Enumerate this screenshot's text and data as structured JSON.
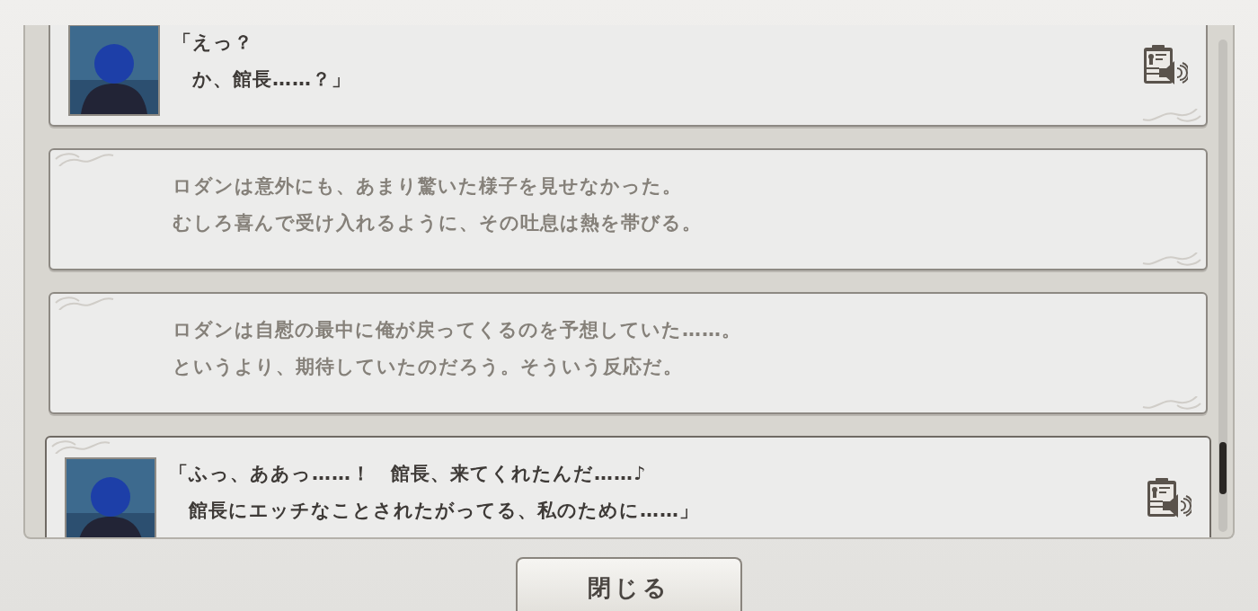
{
  "backlog": {
    "entries": [
      {
        "kind": "voice",
        "selected": false,
        "lines": [
          "「えっ？",
          "　か、館長……？」"
        ]
      },
      {
        "kind": "narration",
        "selected": false,
        "lines": [
          "ロダンは意外にも、あまり驚いた様子を見せなかった。",
          "むしろ喜んで受け入れるように、その吐息は熱を帯びる。"
        ]
      },
      {
        "kind": "narration",
        "selected": false,
        "lines": [
          "ロダンは自慰の最中に俺が戻ってくるのを予想していた……。",
          "というより、期待していたのだろう。そういう反応だ。"
        ]
      },
      {
        "kind": "voice",
        "selected": true,
        "lines": [
          "「ふっ、ああっ……！　館長、来てくれたんだ……♪",
          "　館長にエッチなことされたがってる、私のために……」"
        ]
      }
    ]
  },
  "close_button": {
    "label": "閉じる"
  }
}
